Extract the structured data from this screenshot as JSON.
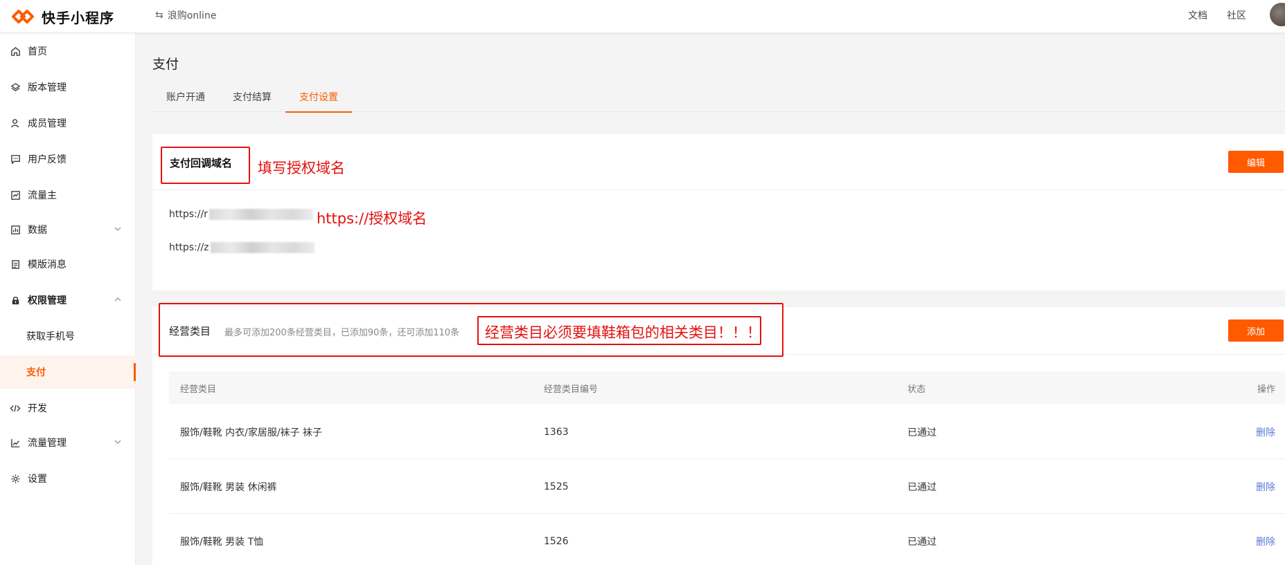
{
  "header": {
    "logo_text": "快手小程序",
    "app_name": "浪购online",
    "swap_icon": "⇆",
    "links": [
      "文档",
      "社区"
    ],
    "brand_color": "#ff5a00"
  },
  "sidebar": {
    "items": [
      {
        "label": "首页",
        "icon": "home-icon"
      },
      {
        "label": "版本管理",
        "icon": "layers-icon"
      },
      {
        "label": "成员管理",
        "icon": "user-icon"
      },
      {
        "label": "用户反馈",
        "icon": "message-icon"
      },
      {
        "label": "流量主",
        "icon": "chart-card-icon"
      },
      {
        "label": "数据",
        "icon": "bar-chart-icon",
        "expandable": true
      },
      {
        "label": "模版消息",
        "icon": "document-icon"
      },
      {
        "label": "权限管理",
        "icon": "lock-icon",
        "expanded": true
      },
      {
        "label": "获取手机号",
        "sub": true
      },
      {
        "label": "支付",
        "sub": true,
        "active": true
      },
      {
        "label": "开发",
        "icon": "code-icon"
      },
      {
        "label": "流量管理",
        "icon": "trend-icon",
        "expandable": true
      },
      {
        "label": "设置",
        "icon": "gear-icon"
      }
    ]
  },
  "main": {
    "title": "支付",
    "tabs": [
      {
        "label": "账户开通"
      },
      {
        "label": "支付结算"
      },
      {
        "label": "支付设置",
        "active": true
      }
    ]
  },
  "callback": {
    "title": "支付回调域名",
    "edit_label": "编辑",
    "annotation": "填写授权域名",
    "urls": [
      "https://r",
      "https://z"
    ],
    "url_annotation": "https://授权域名"
  },
  "categories": {
    "title": "经营类目",
    "hint": "最多可添加200条经营类目，已添加90条，还可添加110条",
    "add_label": "添加",
    "annotation": "经营类目必须要填鞋箱包的相关类目！！！",
    "columns": [
      "经营类目",
      "经营类目编号",
      "状态",
      "操作"
    ],
    "rows": [
      {
        "name": "服饰/鞋靴 内衣/家居服/袜子 袜子",
        "code": "1363",
        "status": "已通过",
        "action": "删除"
      },
      {
        "name": "服饰/鞋靴 男装 休闲裤",
        "code": "1525",
        "status": "已通过",
        "action": "删除"
      },
      {
        "name": "服饰/鞋靴 男装 T恤",
        "code": "1526",
        "status": "已通过",
        "action": "删除"
      }
    ]
  },
  "annotation_color": "#e3110e"
}
